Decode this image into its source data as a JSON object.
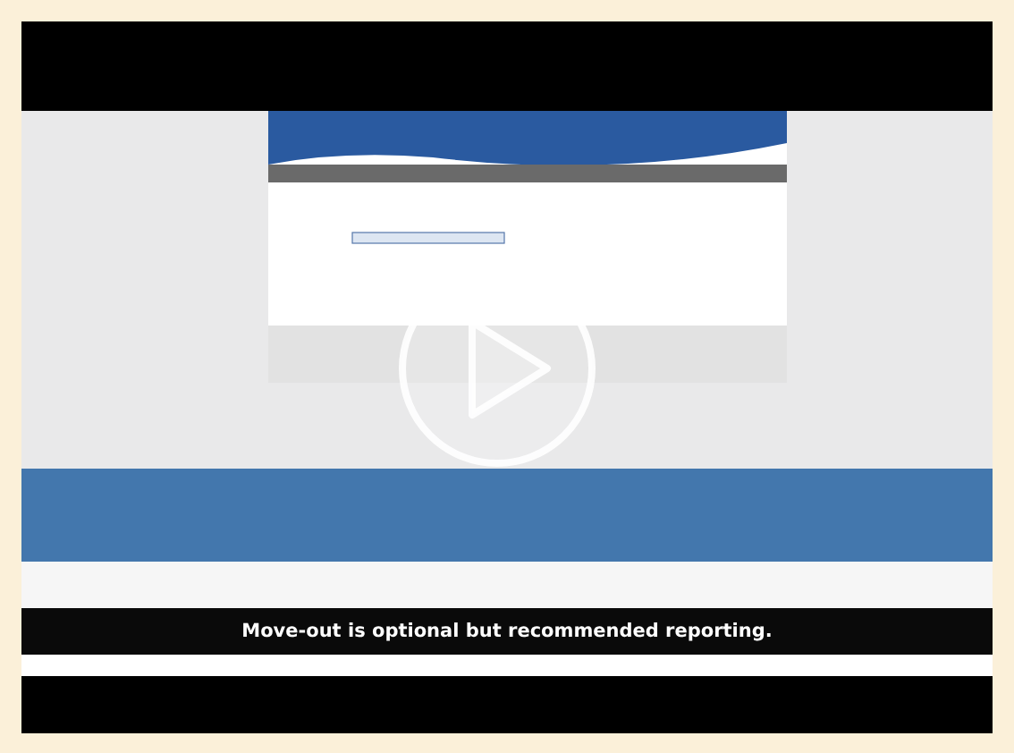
{
  "video": {
    "kind": "picture",
    "caption": "Move-out is optional but recommended reporting."
  }
}
